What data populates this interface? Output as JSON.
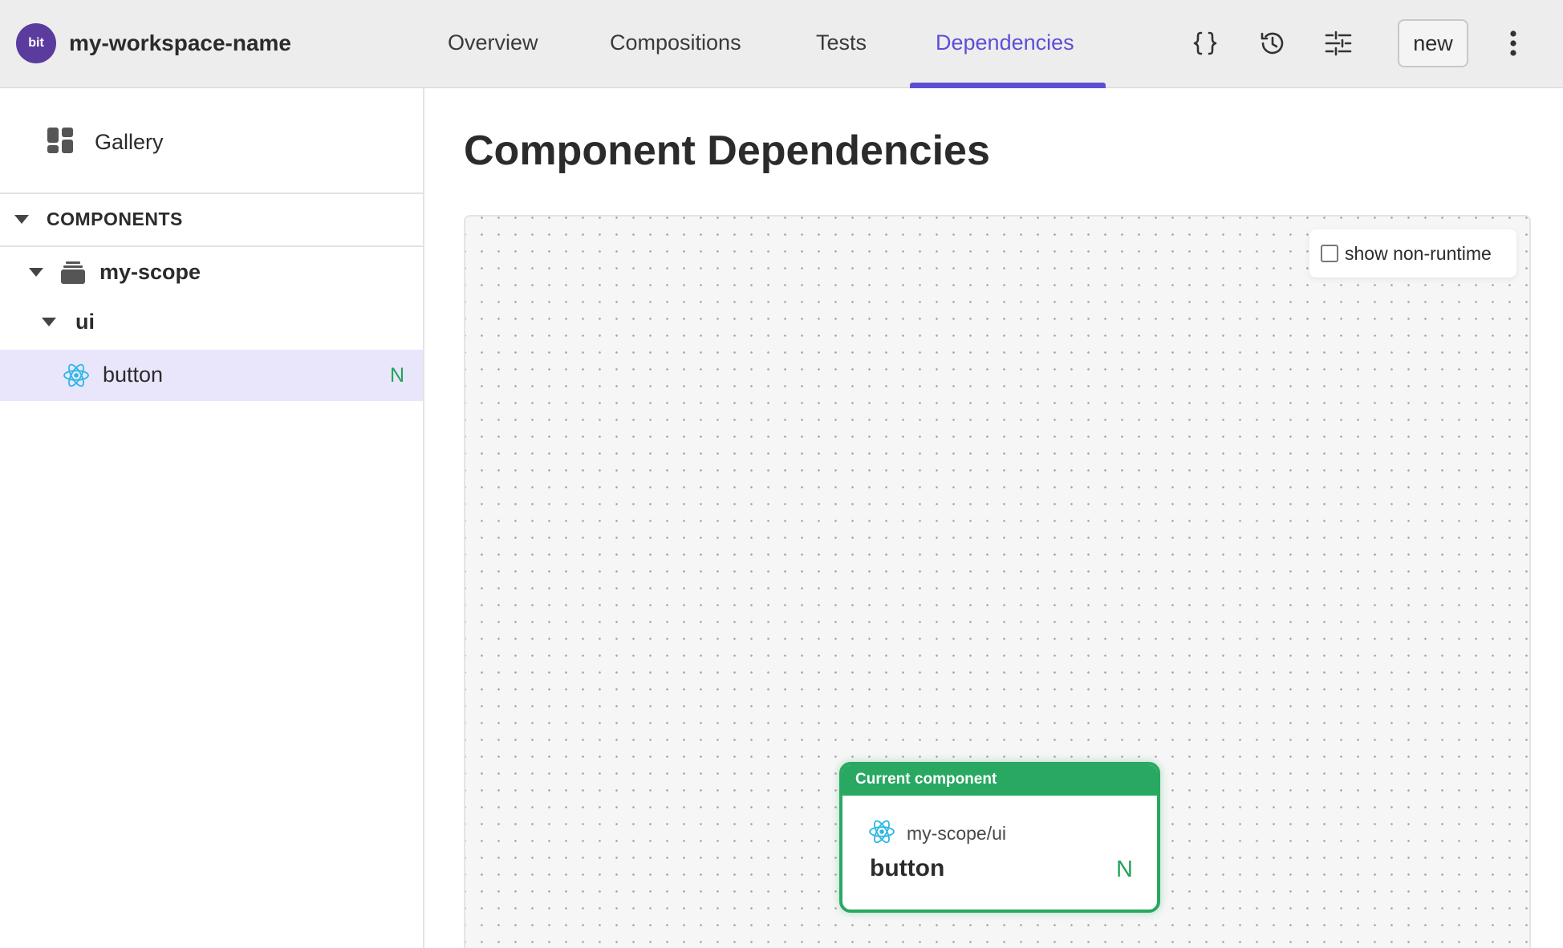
{
  "workspace": {
    "logo_text": "bit",
    "name": "my-workspace-name"
  },
  "tabs": [
    {
      "label": "Overview"
    },
    {
      "label": "Compositions"
    },
    {
      "label": "Tests"
    },
    {
      "label": "Dependencies",
      "active": true
    }
  ],
  "toolbar": {
    "icons": [
      "code-braces-icon",
      "history-icon",
      "settings-sliders-icon",
      "more-vertical-icon"
    ],
    "new_label": "new"
  },
  "sidebar": {
    "gallery_label": "Gallery",
    "section_label": "COMPONENTS",
    "tree": {
      "scope": "my-scope",
      "namespace": "ui",
      "component": {
        "name": "button",
        "status": "N"
      }
    }
  },
  "main": {
    "title": "Component Dependencies",
    "show_non_runtime": {
      "label": "show non-runtime",
      "checked": false
    },
    "node": {
      "header": "Current component",
      "scope": "my-scope/ui",
      "name": "button",
      "status": "N"
    }
  },
  "colors": {
    "accent": "#5c4fd6",
    "current_component": "#29a862",
    "new_status": "#23a35a",
    "logo_bg": "#5b3c9e",
    "react_icon": "#2ab7e6"
  }
}
